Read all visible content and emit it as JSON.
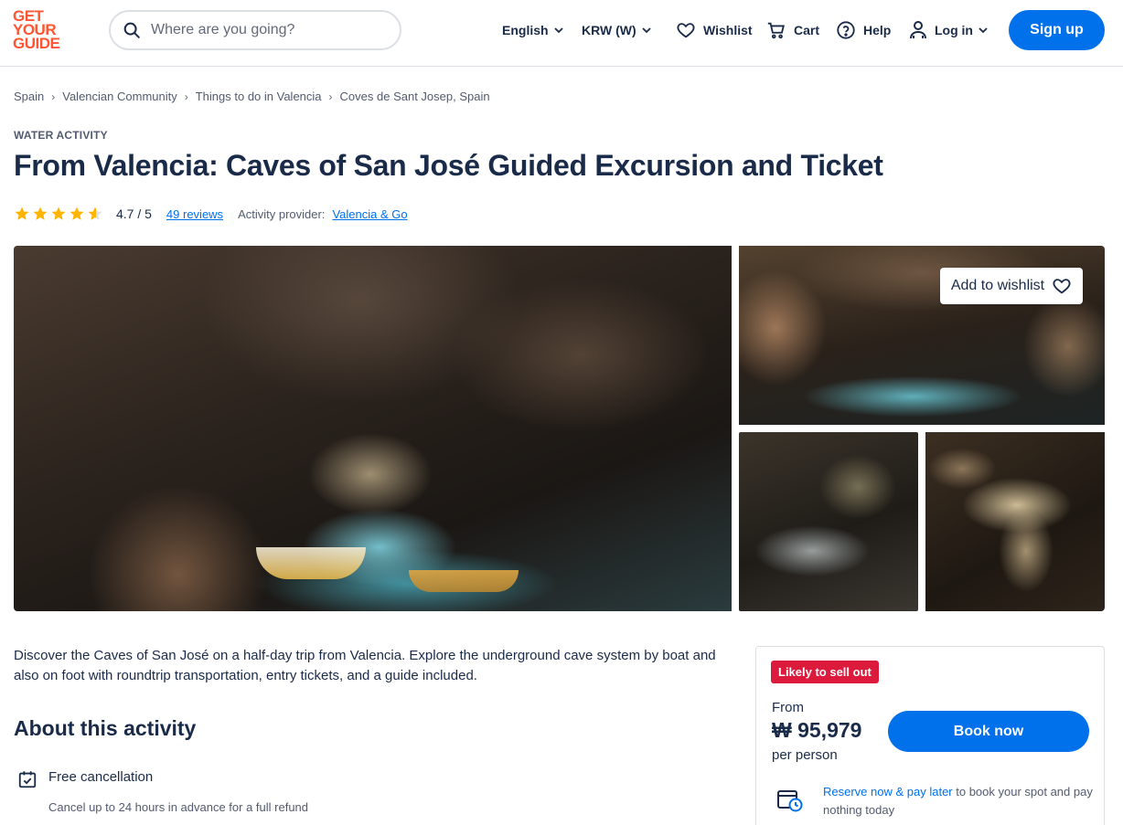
{
  "header": {
    "logo_lines": [
      "GET",
      "YOUR",
      "GUIDE"
    ],
    "search_placeholder": "Where are you going?",
    "language": "English",
    "currency": "KRW (W)",
    "wishlist": "Wishlist",
    "cart": "Cart",
    "help": "Help",
    "login": "Log in",
    "signup": "Sign up"
  },
  "breadcrumb": [
    "Spain",
    "Valencian Community",
    "Things to do in Valencia",
    "Coves de Sant Josep, Spain"
  ],
  "activity": {
    "category": "WATER ACTIVITY",
    "title": "From Valencia: Caves of San José Guided Excursion and Ticket",
    "rating": 4.7,
    "rating_text": "4.7 / 5",
    "reviews": "49 reviews",
    "provider_label": "Activity provider:",
    "provider": "Valencia & Go"
  },
  "gallery": {
    "wishlist_button": "Add to wishlist"
  },
  "description": "Discover the Caves of San José on a half-day trip from Valencia. Explore the underground cave system by boat and also on foot with roundtrip transportation, entry tickets, and a guide included.",
  "about": {
    "heading": "About this activity",
    "features": [
      {
        "title": "Free cancellation",
        "subtitle": "Cancel up to 24 hours in advance for a full refund"
      }
    ]
  },
  "booking": {
    "badge": "Likely to sell out",
    "from": "From",
    "price": "₩ 95,979",
    "per": "per person",
    "book_button": "Book now",
    "reserve_link": "Reserve now & pay later",
    "reserve_text": " to book your spot and pay nothing today"
  },
  "colors": {
    "brand": "#ff5533",
    "accent": "#0071eb",
    "text": "#1a2b49",
    "badge": "#dc1a3c",
    "star": "#ffb400"
  }
}
